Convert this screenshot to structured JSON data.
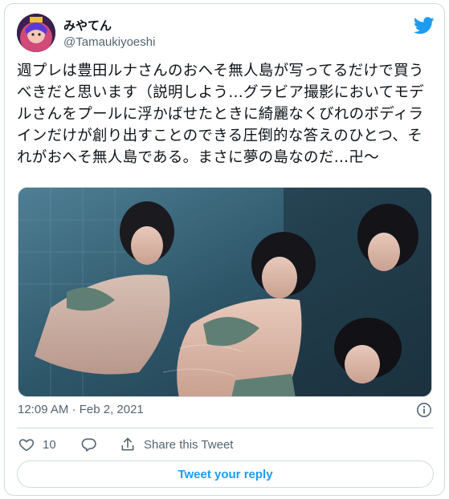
{
  "author": {
    "display_name": "みやてん",
    "handle": "@Tamaukiyoeshi"
  },
  "tweet": {
    "text": "週プレは豊田ルナさんのおへそ無人島が写ってるだけで買うべきだと思います（説明しよう…グラビア撮影においてモデルさんをプールに浮かばせたときに綺麗なくびれのボディラインだけが創り出すことのできる圧倒的な答えのひとつ、それがおへそ無人島である。まさに夢の島なのだ…卍〜",
    "timestamp": "12:09 AM · Feb 2, 2021"
  },
  "actions": {
    "like_count": "10",
    "share_label": "Share this Tweet"
  },
  "reply_button": "Tweet your reply",
  "colors": {
    "accent": "#1d9bf0",
    "secondary_text": "#536471",
    "border": "#cfd9de"
  },
  "icons": [
    "twitter-bird-icon",
    "info-icon",
    "heart-icon",
    "reply-icon",
    "share-icon"
  ]
}
